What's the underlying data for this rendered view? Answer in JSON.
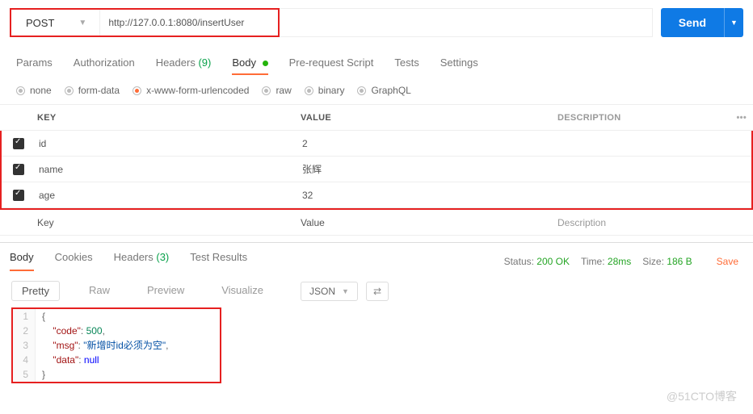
{
  "request": {
    "method": "POST",
    "url": "http://127.0.0.1:8080/insertUser",
    "send_label": "Send"
  },
  "tabs": {
    "params": "Params",
    "auth": "Authorization",
    "headers": "Headers",
    "headers_count": "(9)",
    "body": "Body",
    "prescript": "Pre-request Script",
    "tests": "Tests",
    "settings": "Settings"
  },
  "body_types": {
    "none": "none",
    "formdata": "form-data",
    "urlencoded": "x-www-form-urlencoded",
    "raw": "raw",
    "binary": "binary",
    "graphql": "GraphQL"
  },
  "cols": {
    "key": "KEY",
    "value": "VALUE",
    "desc": "DESCRIPTION"
  },
  "rows": [
    {
      "key": "id",
      "value": "2"
    },
    {
      "key": "name",
      "value": "张辉"
    },
    {
      "key": "age",
      "value": "32"
    }
  ],
  "placeholder": {
    "key": "Key",
    "value": "Value",
    "desc": "Description"
  },
  "resp_tabs": {
    "body": "Body",
    "cookies": "Cookies",
    "headers": "Headers",
    "headers_count": "(3)",
    "tests": "Test Results"
  },
  "status": {
    "s_lbl": "Status:",
    "s_val": "200 OK",
    "t_lbl": "Time:",
    "t_val": "28ms",
    "z_lbl": "Size:",
    "z_val": "186 B",
    "save": "Save"
  },
  "view": {
    "pretty": "Pretty",
    "raw": "Raw",
    "preview": "Preview",
    "visualize": "Visualize",
    "json": "JSON"
  },
  "json": {
    "l1": "{",
    "l2a": "\"code\"",
    "l2b": "500",
    "l3a": "\"msg\"",
    "l3b": "\"新增时id必须为空\"",
    "l4a": "\"data\"",
    "l4b": "null",
    "l5": "}"
  },
  "watermark": "@51CTO博客"
}
